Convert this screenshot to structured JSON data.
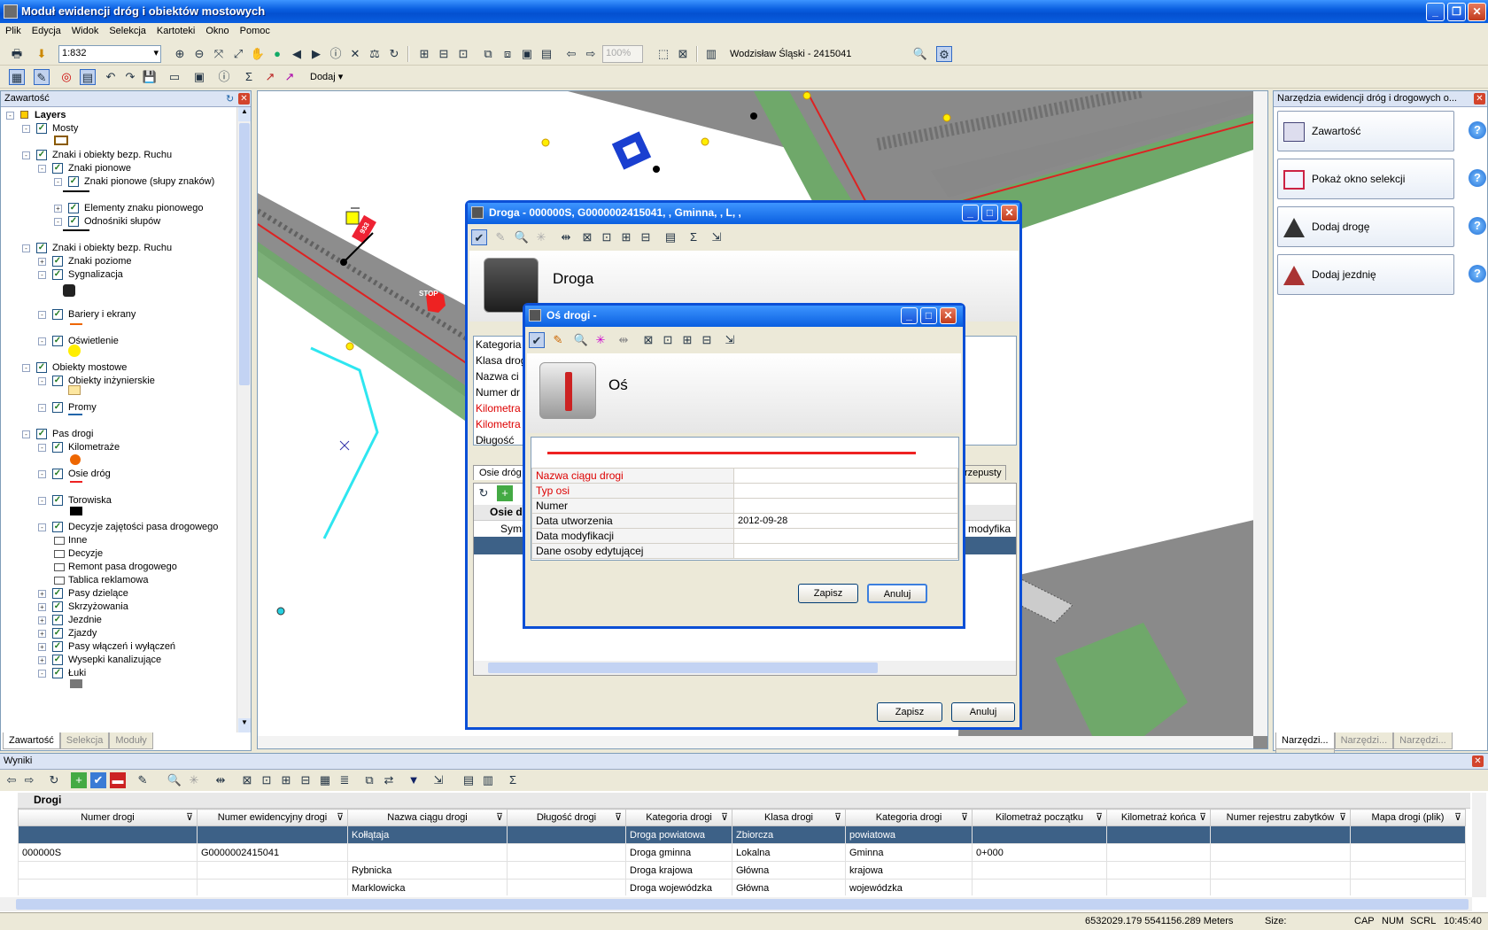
{
  "window": {
    "title": "Moduł ewidencji dróg i obiektów mostowych"
  },
  "menu": [
    "Plik",
    "Edycja",
    "Widok",
    "Selekcja",
    "Kartoteki",
    "Okno",
    "Pomoc"
  ],
  "toolbar1": {
    "scale": "1:832",
    "zoom_pct": "100%",
    "location": "Wodzisław Śląski - 2415041"
  },
  "toolbar2": {
    "add_label": "Dodaj"
  },
  "left_panel": {
    "title": "Zawartość",
    "tree": [
      {
        "label": "Layers",
        "level": 0,
        "checked": null,
        "pm": "-",
        "bold": true
      },
      {
        "label": "Mosty",
        "level": 1,
        "checked": true,
        "pm": "-"
      },
      {
        "label": "Znaki i obiekty bezp. Ruchu",
        "level": 1,
        "checked": true,
        "pm": "-"
      },
      {
        "label": "Znaki pionowe",
        "level": 2,
        "checked": true,
        "pm": "-"
      },
      {
        "label": "Znaki pionowe (słupy znaków)",
        "level": 3,
        "checked": true,
        "pm": "-"
      },
      {
        "label": "Elementy znaku pionowego",
        "level": 3,
        "checked": true,
        "pm": "+"
      },
      {
        "label": "Odnośniki słupów",
        "level": 3,
        "checked": true,
        "pm": "-"
      },
      {
        "label": "Znaki i obiekty bezp. Ruchu",
        "level": 1,
        "checked": true,
        "pm": "-"
      },
      {
        "label": "Znaki poziome",
        "level": 2,
        "checked": true,
        "pm": "+"
      },
      {
        "label": "Sygnalizacja",
        "level": 2,
        "checked": true,
        "pm": "-"
      },
      {
        "label": "Bariery i ekrany",
        "level": 2,
        "checked": true,
        "pm": "-"
      },
      {
        "label": "Oświetlenie",
        "level": 2,
        "checked": true,
        "pm": "-"
      },
      {
        "label": "Obiekty mostowe",
        "level": 1,
        "checked": true,
        "pm": "-"
      },
      {
        "label": "Obiekty inżynierskie",
        "level": 2,
        "checked": true,
        "pm": "-"
      },
      {
        "label": "Promy",
        "level": 2,
        "checked": true,
        "pm": "-"
      },
      {
        "label": "Pas drogi",
        "level": 1,
        "checked": true,
        "pm": "-"
      },
      {
        "label": "Kilometraże",
        "level": 2,
        "checked": true,
        "pm": "-"
      },
      {
        "label": "Osie dróg",
        "level": 2,
        "checked": true,
        "pm": "-"
      },
      {
        "label": "Torowiska",
        "level": 2,
        "checked": true,
        "pm": "-"
      },
      {
        "label": "Decyzje zajętości pasa drogowego",
        "level": 2,
        "checked": true,
        "pm": "-"
      },
      {
        "label": "Inne",
        "level": 3,
        "checked": null,
        "pm": null
      },
      {
        "label": "Decyzje",
        "level": 3,
        "checked": null,
        "pm": null
      },
      {
        "label": "Remont pasa drogowego",
        "level": 3,
        "checked": null,
        "pm": null
      },
      {
        "label": "Tablica reklamowa",
        "level": 3,
        "checked": null,
        "pm": null
      },
      {
        "label": "Pasy dzielące",
        "level": 2,
        "checked": true,
        "pm": "+"
      },
      {
        "label": "Skrzyżowania",
        "level": 2,
        "checked": true,
        "pm": "+"
      },
      {
        "label": "Jezdnie",
        "level": 2,
        "checked": true,
        "pm": "+"
      },
      {
        "label": "Zjazdy",
        "level": 2,
        "checked": true,
        "pm": "+"
      },
      {
        "label": "Pasy włączeń i wyłączeń",
        "level": 2,
        "checked": true,
        "pm": "+"
      },
      {
        "label": "Wysepki kanalizujące",
        "level": 2,
        "checked": true,
        "pm": "+"
      },
      {
        "label": "Łuki",
        "level": 2,
        "checked": true,
        "pm": "-"
      }
    ],
    "tabs": [
      "Zawartość",
      "Selekcja",
      "Moduły"
    ]
  },
  "right_panel": {
    "title": "Narzędzia ewidencji dróg i drogowych o...",
    "buttons": [
      "Zawartość",
      "Pokaż okno selekcji",
      "Dodaj drogę",
      "Dodaj jezdnię"
    ],
    "tabs": [
      "Narzędzi...",
      "Narzędzi...",
      "Narzędzi...",
      "Narzędzi..."
    ]
  },
  "map": {
    "stop_label": "STOP",
    "sign_label": "933"
  },
  "droga_dialog": {
    "title": "Droga - 000000S, G0000002415041, , Gminna, , L, ,",
    "heading": "Droga",
    "fields": [
      "Kategoria",
      "Klasa drogi",
      "Nazwa ci",
      "Numer dr",
      "Kilometra",
      "Kilometra",
      "Długość"
    ],
    "tabs": [
      "Osie dróg",
      "rzepusty"
    ],
    "sub_header": "Osie dr",
    "col_symbol": "Symb",
    "col_mod": "a modyfika",
    "save": "Zapisz",
    "cancel": "Anuluj"
  },
  "os_dialog": {
    "title": "Oś drogi -",
    "heading": "Oś",
    "props": [
      {
        "label": "Nazwa ciągu drogi",
        "value": "",
        "required": true
      },
      {
        "label": "Typ osi",
        "value": "",
        "required": true
      },
      {
        "label": "Numer",
        "value": "",
        "required": false
      },
      {
        "label": "Data utworzenia",
        "value": "2012-09-28",
        "required": false
      },
      {
        "label": "Data modyfikacji",
        "value": "",
        "required": false
      },
      {
        "label": "Dane osoby edytującej",
        "value": "",
        "required": false
      }
    ],
    "save": "Zapisz",
    "cancel": "Anuluj"
  },
  "results": {
    "title": "Wyniki",
    "group": "Drogi",
    "columns": [
      "Numer drogi",
      "Numer ewidencyjny drogi",
      "Nazwa ciągu drogi",
      "Długość drogi",
      "Kategoria drogi",
      "Klasa drogi",
      "Kategoria drogi",
      "Kilometraż początku",
      "Kilometraż końca",
      "Numer rejestru zabytków",
      "Mapa drogi (plik)"
    ],
    "rows": [
      [
        "",
        "",
        "Kołłątaja",
        "",
        "Droga powiatowa",
        "Zbiorcza",
        "powiatowa",
        "",
        "",
        "",
        ""
      ],
      [
        "000000S",
        "G0000002415041",
        "",
        "",
        "Droga gminna",
        "Lokalna",
        "Gminna",
        "0+000",
        "",
        "",
        ""
      ],
      [
        "",
        "",
        "Rybnicka",
        "",
        "Droga krajowa",
        "Główna",
        "krajowa",
        "",
        "",
        "",
        ""
      ],
      [
        "",
        "",
        "Marklowicka",
        "",
        "Droga wojewódzka",
        "Główna",
        "wojewódzka",
        "",
        "",
        "",
        ""
      ]
    ]
  },
  "status": {
    "coords": "6532029.179  5541156.289 Meters",
    "size": "Size:",
    "cap": "CAP",
    "num": "NUM",
    "scrl": "SCRL",
    "time": "10:45:40"
  }
}
